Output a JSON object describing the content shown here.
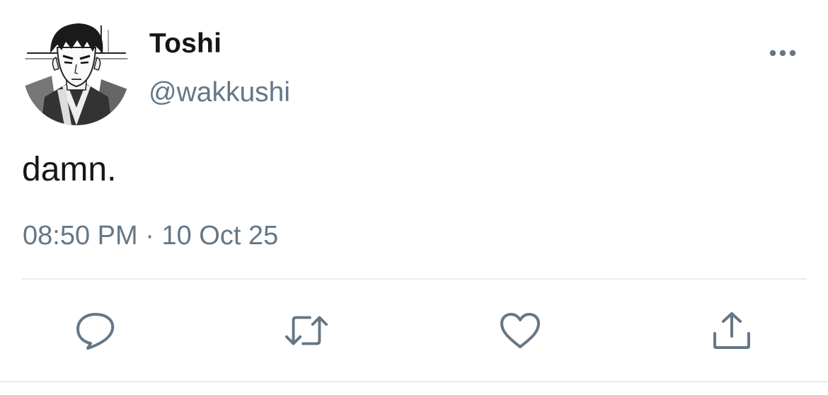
{
  "tweet": {
    "display_name": "Toshi",
    "handle": "@wakkushi",
    "text": "damn.",
    "time": "08:50 PM",
    "separator": " · ",
    "date": "10 Oct 25"
  },
  "icons": {
    "more": "more-horizontal-icon",
    "reply": "reply-icon",
    "retweet": "retweet-icon",
    "like": "heart-icon",
    "share": "share-icon"
  },
  "colors": {
    "text": "#14171a",
    "secondary": "#657786",
    "divider": "#e6ecf0"
  }
}
